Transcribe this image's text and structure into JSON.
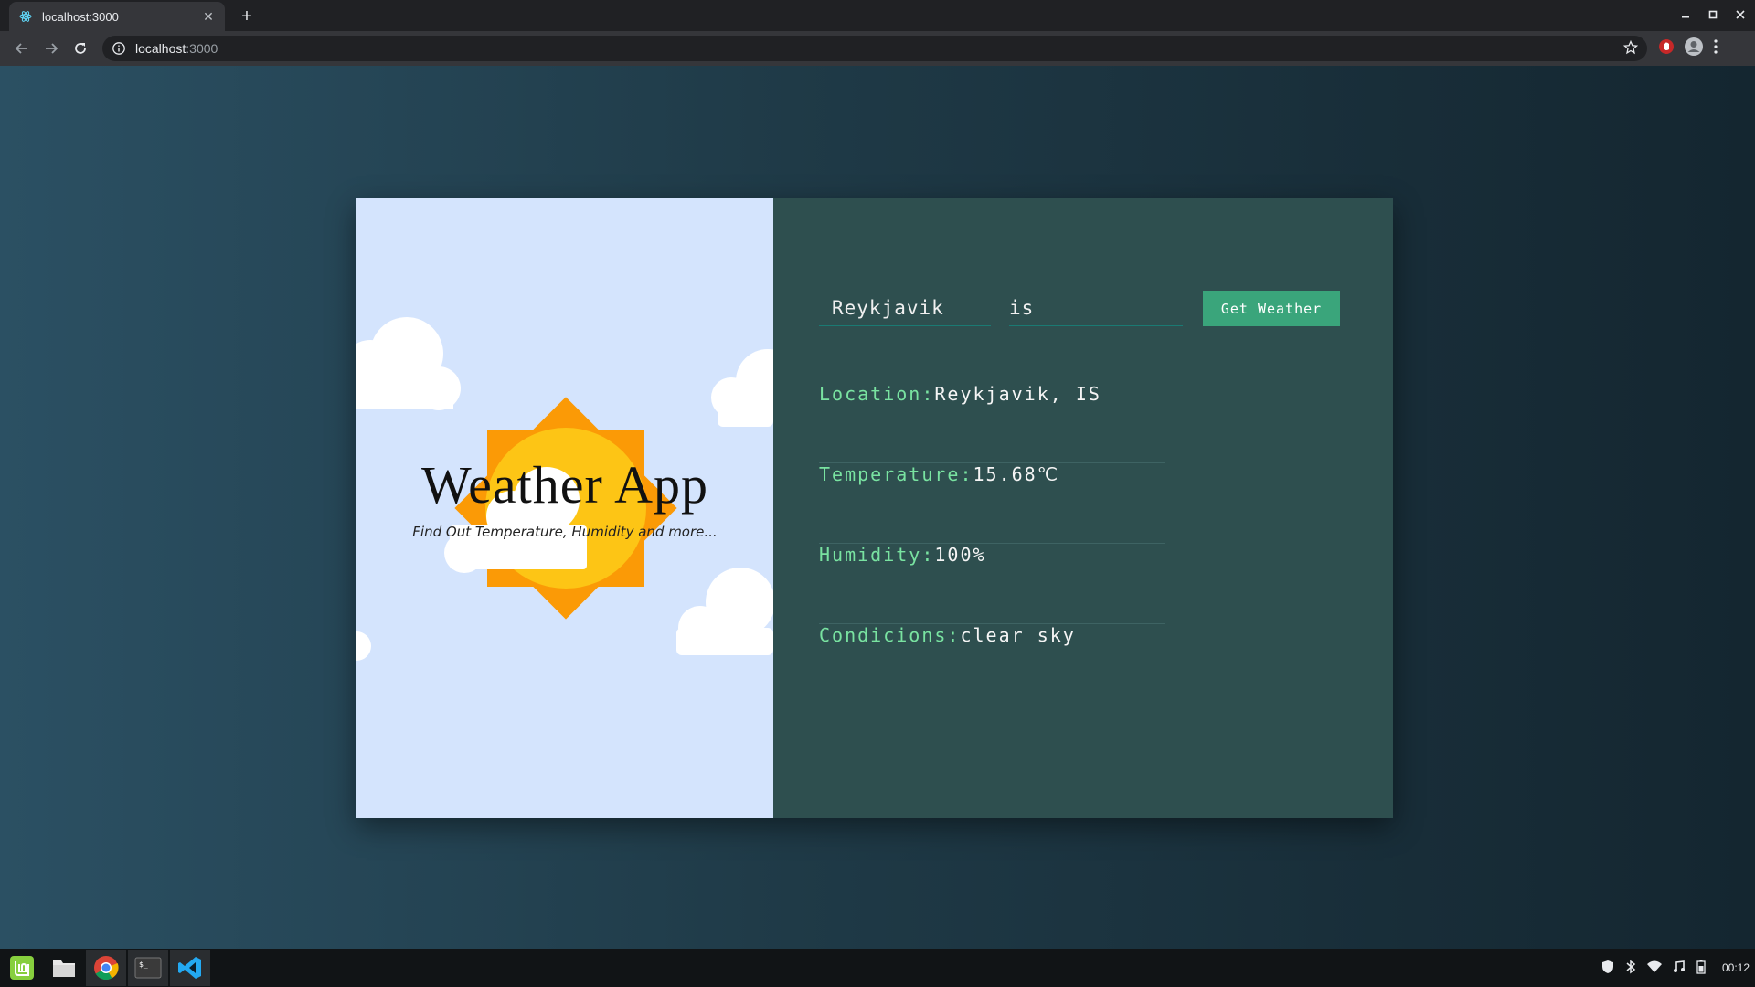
{
  "browser": {
    "tab_title": "localhost:3000",
    "url_host": "localhost",
    "url_port": ":3000",
    "new_tab_glyph": "+",
    "close_glyph": "✕"
  },
  "hero": {
    "title": "Weather App",
    "subtitle": "Find Out Temperature, Humidity and more..."
  },
  "form": {
    "city_value": "Reykjavik",
    "country_value": "is",
    "button_label": "Get Weather"
  },
  "results": [
    {
      "label": "Location:",
      "value": "Reykjavik, IS"
    },
    {
      "label": "Temperature:",
      "value": "15.68℃"
    },
    {
      "label": "Humidity:",
      "value": "100%"
    },
    {
      "label": "Condicions:",
      "value": "clear sky"
    }
  ],
  "taskbar": {
    "clock": "00:12"
  },
  "colors": {
    "accent": "#3aa57b",
    "label": "#79e3a1",
    "panel": "#2e4f4f",
    "hero_bg": "#d4e4fd"
  }
}
